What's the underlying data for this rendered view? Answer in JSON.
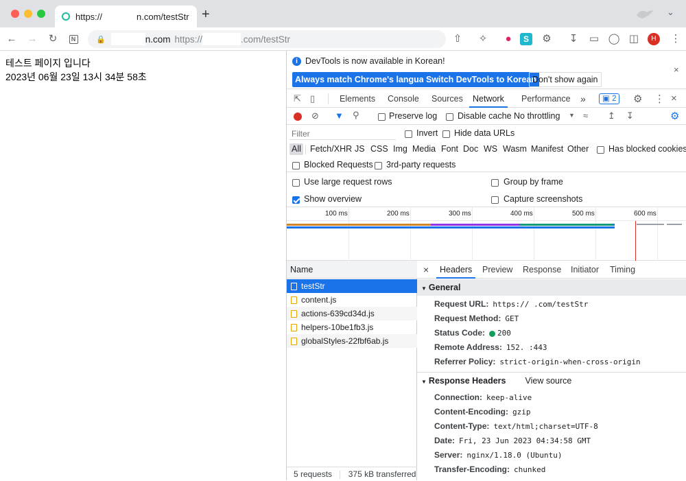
{
  "browser": {
    "tab_title": "https://",
    "tab_title_suffix": "n.com/testStr",
    "new_tab": "+",
    "omnibox_domain": "n.com",
    "omnibox_url_prefix": "https://",
    "omnibox_url_suffix": ".com/testStr",
    "profile_initial": "H",
    "colors": {
      "accent": "#1a73e8",
      "close": "#ff5f57",
      "minimize": "#febc2e",
      "maximize": "#28c840"
    }
  },
  "page": {
    "line1": "테스트 페이지 입니다",
    "line2": "2023년 06월 23일 13시 34분 58초"
  },
  "infobar": {
    "message": "DevTools is now available in Korean!",
    "btn_match": "Always match Chrome's language",
    "btn_switch": "Switch DevTools to Korean",
    "btn_dont": "Don't show again"
  },
  "devtools_tabs": {
    "items": [
      "Elements",
      "Console",
      "Sources",
      "Network",
      "Performance"
    ],
    "active": "Network",
    "more": "»",
    "issues_count": "2"
  },
  "network_toolbar": {
    "preserve_log": "Preserve log",
    "disable_cache": "Disable cache",
    "throttling": "No throttling"
  },
  "filter": {
    "placeholder": "Filter",
    "invert": "Invert",
    "hide_data_urls": "Hide data URLs"
  },
  "types": {
    "items": [
      "All",
      "Fetch/XHR",
      "JS",
      "CSS",
      "Img",
      "Media",
      "Font",
      "Doc",
      "WS",
      "Wasm",
      "Manifest",
      "Other"
    ],
    "selected": "All",
    "has_blocked_cookies": "Has blocked cookies",
    "blocked_requests": "Blocked Requests",
    "third_party": "3rd-party requests"
  },
  "settings": {
    "large_rows": "Use large request rows",
    "group_by_frame": "Group by frame",
    "show_overview": "Show overview",
    "capture_screenshots": "Capture screenshots"
  },
  "overview": {
    "ticks": [
      "100 ms",
      "200 ms",
      "300 ms",
      "400 ms",
      "500 ms",
      "600 ms"
    ]
  },
  "requests": {
    "header": "Name",
    "items": [
      "testStr",
      "content.js",
      "actions-639cd34d.js",
      "helpers-10be1fb3.js",
      "globalStyles-22fbf6ab.js"
    ],
    "footer_count": "5 requests",
    "footer_transferred": "375 kB transferred"
  },
  "detail": {
    "close": "×",
    "tabs": [
      "Headers",
      "Preview",
      "Response",
      "Initiator",
      "Timing"
    ],
    "active_tab": "Headers",
    "general_title": "General",
    "general": [
      {
        "key": "Request URL:",
        "value": "https://          .com/testStr"
      },
      {
        "key": "Request Method:",
        "value": "GET"
      },
      {
        "key": "Status Code:",
        "value": "200"
      },
      {
        "key": "Remote Address:",
        "value": "152.          :443"
      },
      {
        "key": "Referrer Policy:",
        "value": "strict-origin-when-cross-origin"
      }
    ],
    "response_title": "Response Headers",
    "view_source": "View source",
    "response": [
      {
        "key": "Connection:",
        "value": "keep-alive"
      },
      {
        "key": "Content-Encoding:",
        "value": "gzip"
      },
      {
        "key": "Content-Type:",
        "value": "text/html;charset=UTF-8"
      },
      {
        "key": "Date:",
        "value": "Fri, 23 Jun 2023 04:34:58 GMT"
      },
      {
        "key": "Server:",
        "value": "nginx/1.18.0 (Ubuntu)"
      },
      {
        "key": "Transfer-Encoding:",
        "value": "chunked"
      }
    ]
  }
}
